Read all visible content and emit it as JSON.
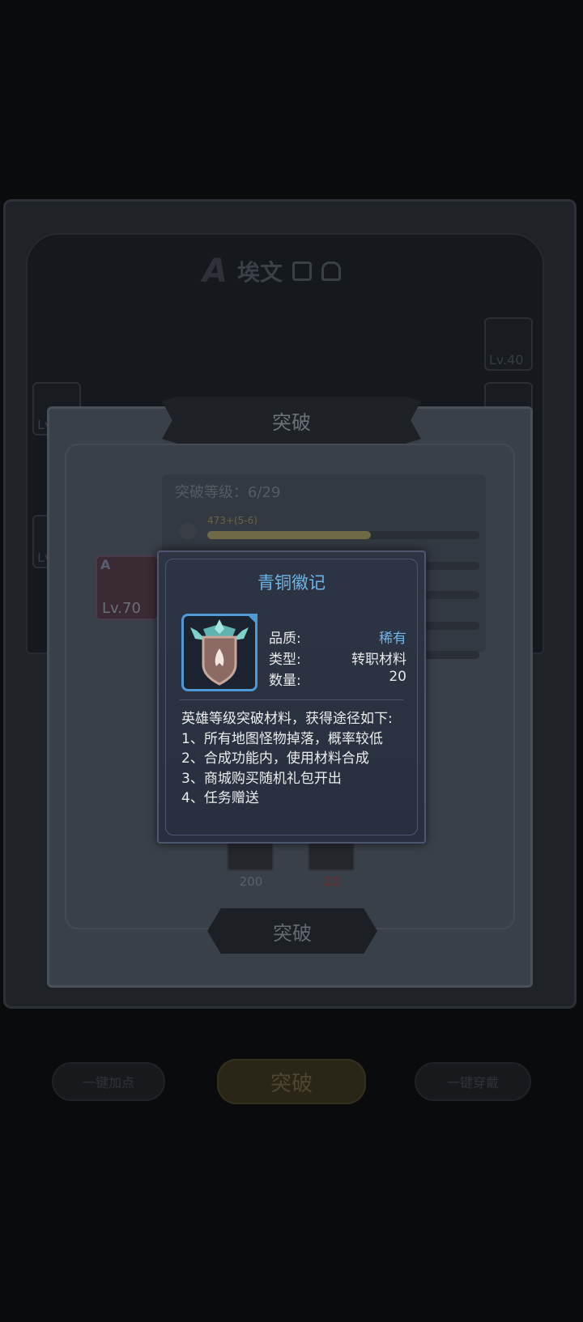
{
  "background": {
    "hero_name": "埃文",
    "hero_grade": "A",
    "side_slot_level": "Lv.40",
    "left_slot_label_1": "Lv",
    "left_slot_label_2": "Lv",
    "bottom_nav": {
      "left_label": "一键加点",
      "center_label": "突破",
      "right_label": "一键穿戴"
    }
  },
  "breakthrough_dialog": {
    "title": "突破",
    "level_label": "突破等级：6/29",
    "stat_bar_label": "473+(5-6)",
    "stat_bar_progress": 0.6,
    "hero_card": {
      "grade": "A",
      "level": "Lv.70"
    },
    "materials": [
      {
        "count": "200",
        "insufficient": false
      },
      {
        "count": "20",
        "insufficient": true
      }
    ],
    "confirm_label": "突破"
  },
  "item_tooltip": {
    "name": "青铜徽记",
    "quality_label": "品质:",
    "quality_value": "稀有",
    "type_label": "类型:",
    "type_value": "转职材料",
    "quantity_label": "数量:",
    "quantity_value": "20",
    "description_line_1": "英雄等级突破材料，获得途径如下:",
    "description_line_2": "1、所有地图怪物掉落，概率较低",
    "description_line_3": "2、合成功能内，使用材料合成",
    "description_line_4": "3、商城购买随机礼包开出",
    "description_line_5": "4、任务赠送",
    "colors": {
      "title": "#6fb6e8",
      "rare": "#6fb6e8",
      "border": "#4f9ad6"
    }
  }
}
